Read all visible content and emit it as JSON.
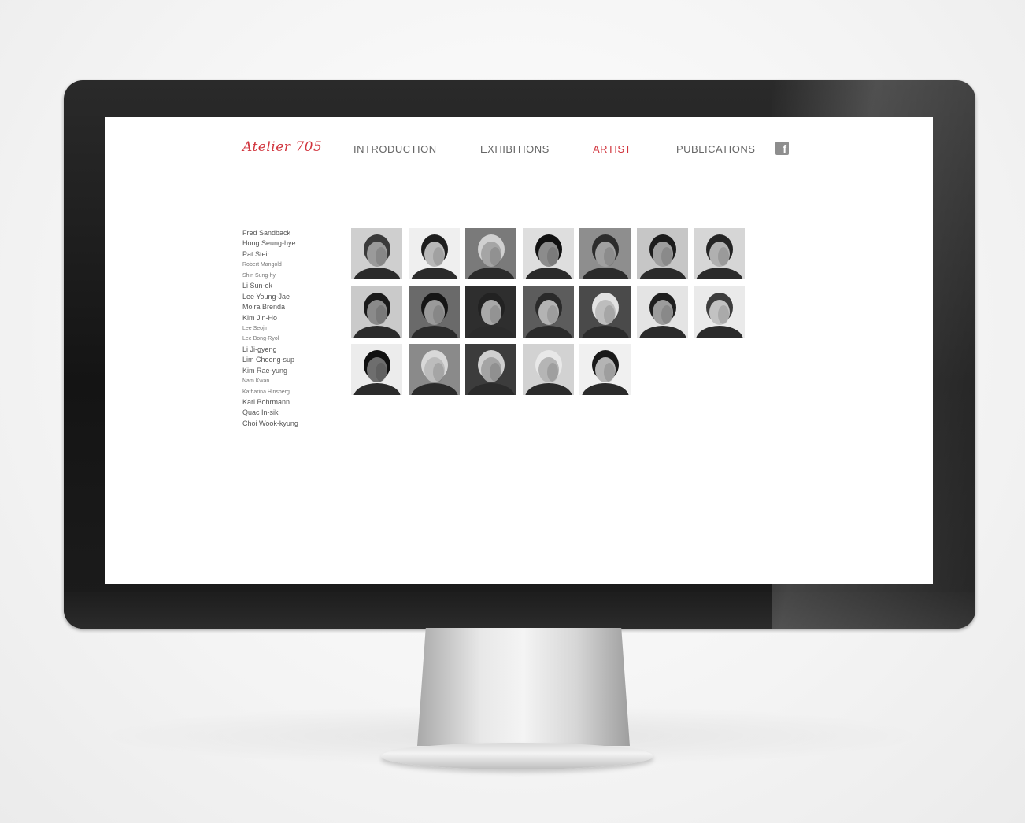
{
  "logo": {
    "text": "Atelier 705"
  },
  "nav": [
    {
      "label": "INTRODUCTION",
      "active": false
    },
    {
      "label": "EXHIBITIONS",
      "active": false
    },
    {
      "label": "ARTIST",
      "active": true
    },
    {
      "label": "PUBLICATIONS",
      "active": false
    }
  ],
  "social": {
    "icon": "facebook-icon",
    "glyph": "f"
  },
  "colors": {
    "accent": "#d1343d",
    "nav_text": "#666666",
    "screen_bg": "#ffffff",
    "bezel": "#1a1a1a"
  },
  "artists": [
    "Fred Sandback",
    "Hong Seung-hye",
    "Pat Steir",
    "Robert Mangold",
    "Shin Sung-hy",
    "Li Sun-ok",
    "Lee Young-Jae",
    "Moira Brenda",
    "Kim Jin-Ho",
    "Lee Seojin",
    "Lee Bong-Ryol",
    "Li Ji-gyeng",
    "Lim Choong-sup",
    "Kim Rae-yung",
    "Nam Kwan",
    "Katharina Hinsberg",
    "Karl Bohrmann",
    "Quac In-sik",
    "Choi Wook-kyung"
  ],
  "portraits": [
    {
      "row": 0,
      "col": 0,
      "tone": "#9a9a9a",
      "bg": "#cfcfcf",
      "hair": "#3a3a3a"
    },
    {
      "row": 0,
      "col": 1,
      "tone": "#b8b8b8",
      "bg": "#efefef",
      "hair": "#1e1e1e"
    },
    {
      "row": 0,
      "col": 2,
      "tone": "#a5a5a5",
      "bg": "#7a7a7a",
      "hair": "#d0d0d0"
    },
    {
      "row": 0,
      "col": 3,
      "tone": "#8c8c8c",
      "bg": "#dedede",
      "hair": "#111111"
    },
    {
      "row": 0,
      "col": 4,
      "tone": "#a0a0a0",
      "bg": "#8e8e8e",
      "hair": "#2c2c2c"
    },
    {
      "row": 0,
      "col": 5,
      "tone": "#9e9e9e",
      "bg": "#c6c6c6",
      "hair": "#1c1c1c"
    },
    {
      "row": 0,
      "col": 6,
      "tone": "#b0b0b0",
      "bg": "#d6d6d6",
      "hair": "#242424"
    },
    {
      "row": 1,
      "col": 0,
      "tone": "#8a8a8a",
      "bg": "#cacaca",
      "hair": "#1a1a1a"
    },
    {
      "row": 1,
      "col": 1,
      "tone": "#9a9a9a",
      "bg": "#6a6a6a",
      "hair": "#151515"
    },
    {
      "row": 1,
      "col": 2,
      "tone": "#a8a8a8",
      "bg": "#2e2e2e",
      "hair": "#222222"
    },
    {
      "row": 1,
      "col": 3,
      "tone": "#b3b3b3",
      "bg": "#5c5c5c",
      "hair": "#2a2a2a"
    },
    {
      "row": 1,
      "col": 4,
      "tone": "#bdbdbd",
      "bg": "#4a4a4a",
      "hair": "#e2e2e2"
    },
    {
      "row": 1,
      "col": 5,
      "tone": "#9c9c9c",
      "bg": "#e4e4e4",
      "hair": "#1f1f1f"
    },
    {
      "row": 1,
      "col": 6,
      "tone": "#c2c2c2",
      "bg": "#eaeaea",
      "hair": "#3d3d3d"
    },
    {
      "row": 2,
      "col": 0,
      "tone": "#6e6e6e",
      "bg": "#ececec",
      "hair": "#101010"
    },
    {
      "row": 2,
      "col": 1,
      "tone": "#bcbcbc",
      "bg": "#8a8a8a",
      "hair": "#d8d8d8"
    },
    {
      "row": 2,
      "col": 2,
      "tone": "#a4a4a4",
      "bg": "#3c3c3c",
      "hair": "#cfcfcf"
    },
    {
      "row": 2,
      "col": 3,
      "tone": "#b5b5b5",
      "bg": "#d2d2d2",
      "hair": "#e8e8e8"
    },
    {
      "row": 2,
      "col": 4,
      "tone": "#b4b4b4",
      "bg": "#f0f0f0",
      "hair": "#1a1a1a"
    }
  ]
}
